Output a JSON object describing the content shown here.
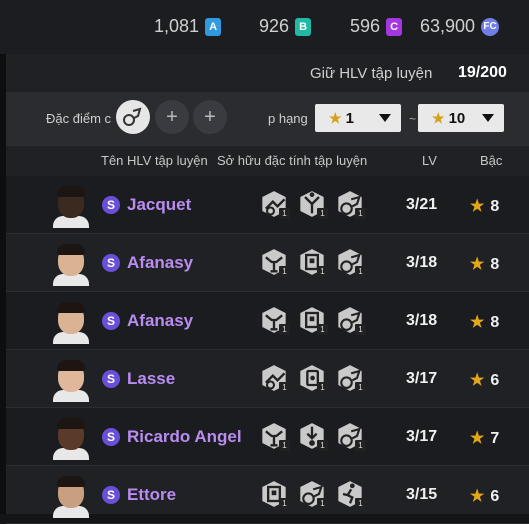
{
  "currency": {
    "a_value": "1,081",
    "a_badge": "A",
    "b_value": "926",
    "b_badge": "B",
    "c_value": "596",
    "c_badge": "C",
    "fc_value": "63,900",
    "fc_badge": "FC"
  },
  "slots": {
    "label": "Giữ HLV tập luyện",
    "value": "19/200"
  },
  "filter": {
    "trait_label": "Đặc điểm c",
    "rank_label": "p hạng",
    "min_grade": "1",
    "max_grade": "10",
    "separator": "~",
    "add_symbol": "+"
  },
  "columns": {
    "name": "Tên HLV tập luyện",
    "traits": "Sở hữu đặc tính tập luyện",
    "lv": "LV",
    "grade": "Bậc"
  },
  "coach_badge": "S",
  "trait_level": "1",
  "star": "★",
  "rows": [
    {
      "name": "Jacquet",
      "lv": "3/21",
      "grade": "8",
      "skin": "#3b2a20",
      "traits": [
        "tackle-trait-icon",
        "jump-trait-icon",
        "dribble-trait-icon"
      ]
    },
    {
      "name": "Afanasy",
      "lv": "3/18",
      "grade": "8",
      "skin": "#d9b393",
      "traits": [
        "strength-trait-icon",
        "shield-trait-icon",
        "dribble-trait-icon"
      ]
    },
    {
      "name": "Afanasy",
      "lv": "3/18",
      "grade": "8",
      "skin": "#d9b393",
      "traits": [
        "strength-trait-icon",
        "shield-trait-icon",
        "dribble-trait-icon"
      ]
    },
    {
      "name": "Lasse",
      "lv": "3/17",
      "grade": "6",
      "skin": "#e0b79a",
      "traits": [
        "tackle-trait-icon",
        "card-trait-icon",
        "dribble-trait-icon"
      ]
    },
    {
      "name": "Ricardo Angel",
      "lv": "3/17",
      "grade": "7",
      "skin": "#5a3a28",
      "traits": [
        "strength-trait-icon",
        "pass-trait-icon",
        "dribble-trait-icon"
      ]
    },
    {
      "name": "Ettore",
      "lv": "3/15",
      "grade": "6",
      "skin": "#c9a07f",
      "traits": [
        "shield-trait-icon",
        "dribble-trait-icon",
        "run-trait-icon"
      ]
    }
  ],
  "colors": {
    "a": "#2f9ae0",
    "b": "#1fb9a6",
    "c": "#a437e0",
    "fc": "#6f7fe6",
    "name": "#b98cf0",
    "star": "#e2a71d"
  }
}
